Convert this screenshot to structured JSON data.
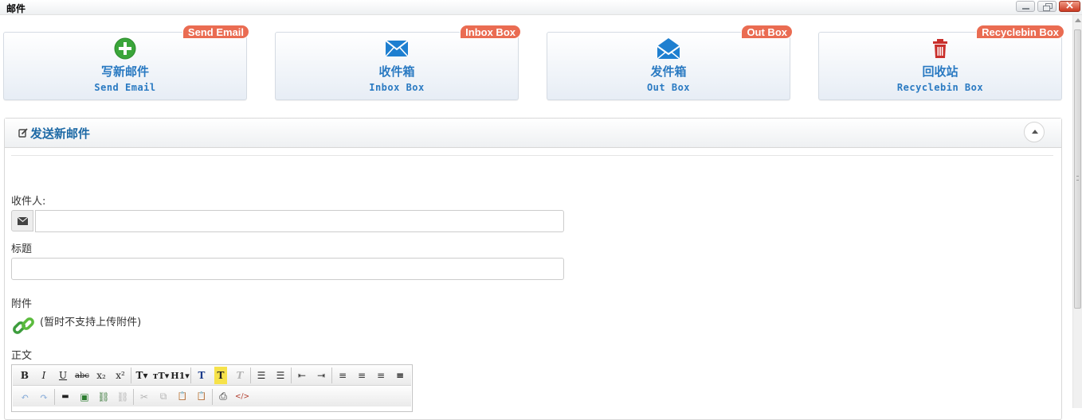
{
  "window": {
    "title": "邮件"
  },
  "cards": [
    {
      "badge": "Send Email",
      "title_cn": "写新邮件",
      "title_en": "Send Email",
      "icon": "plus-circle-icon",
      "color": "#3aa53a"
    },
    {
      "badge": "Inbox Box",
      "title_cn": "收件箱",
      "title_en": "Inbox Box",
      "icon": "envelope-icon",
      "color": "#1e7fd0"
    },
    {
      "badge": "Out Box",
      "title_cn": "发件箱",
      "title_en": "Out Box",
      "icon": "envelope-open-icon",
      "color": "#1e7fd0"
    },
    {
      "badge": "Recyclebin Box",
      "title_cn": "回收站",
      "title_en": "Recyclebin Box",
      "icon": "trash-icon",
      "color": "#c9302c"
    }
  ],
  "compose": {
    "title": "发送新邮件",
    "recipient_label": "收件人:",
    "recipient_value": "",
    "subject_label": "标题",
    "subject_value": "",
    "attachment_label": "附件",
    "attachment_note": "(暂时不支持上传附件)",
    "body_label": "正文"
  },
  "toolbar": {
    "row1": [
      {
        "name": "bold-button",
        "glyph": "B"
      },
      {
        "name": "italic-button",
        "glyph": "I"
      },
      {
        "name": "underline-button",
        "glyph": "U"
      },
      {
        "name": "strikethrough-button",
        "glyph": "abc"
      },
      {
        "name": "subscript-button",
        "glyph": "x₂"
      },
      {
        "name": "superscript-button",
        "glyph": "x²"
      },
      {
        "name": "font-family-button",
        "glyph": "T▾"
      },
      {
        "name": "font-size-button",
        "glyph": "тT▾"
      },
      {
        "name": "heading-button",
        "glyph": "H1▾"
      },
      {
        "name": "font-color-button",
        "glyph": "T"
      },
      {
        "name": "highlight-button",
        "glyph": "T"
      },
      {
        "name": "clear-format-button",
        "glyph": "T"
      },
      {
        "name": "bullet-list-button",
        "glyph": "☰"
      },
      {
        "name": "numbered-list-button",
        "glyph": "☰"
      },
      {
        "name": "outdent-button",
        "glyph": "⇤"
      },
      {
        "name": "indent-button",
        "glyph": "⇥"
      },
      {
        "name": "align-left-button",
        "glyph": "≡"
      },
      {
        "name": "align-center-button",
        "glyph": "≡"
      },
      {
        "name": "align-right-button",
        "glyph": "≡"
      },
      {
        "name": "justify-button",
        "glyph": "≡"
      }
    ],
    "row2": [
      {
        "name": "undo-button",
        "glyph": "↶"
      },
      {
        "name": "redo-button",
        "glyph": "↷"
      },
      {
        "name": "horizontal-rule-button",
        "glyph": "▬"
      },
      {
        "name": "insert-image-button",
        "glyph": "▣"
      },
      {
        "name": "insert-link-button",
        "glyph": "⛓"
      },
      {
        "name": "unlink-button",
        "glyph": "⛓"
      },
      {
        "name": "cut-button",
        "glyph": "✂"
      },
      {
        "name": "copy-button",
        "glyph": "⧉"
      },
      {
        "name": "paste-button",
        "glyph": "📋"
      },
      {
        "name": "paste-text-button",
        "glyph": "📋"
      },
      {
        "name": "print-button",
        "glyph": "⎙"
      },
      {
        "name": "source-code-button",
        "glyph": "</>"
      }
    ]
  }
}
